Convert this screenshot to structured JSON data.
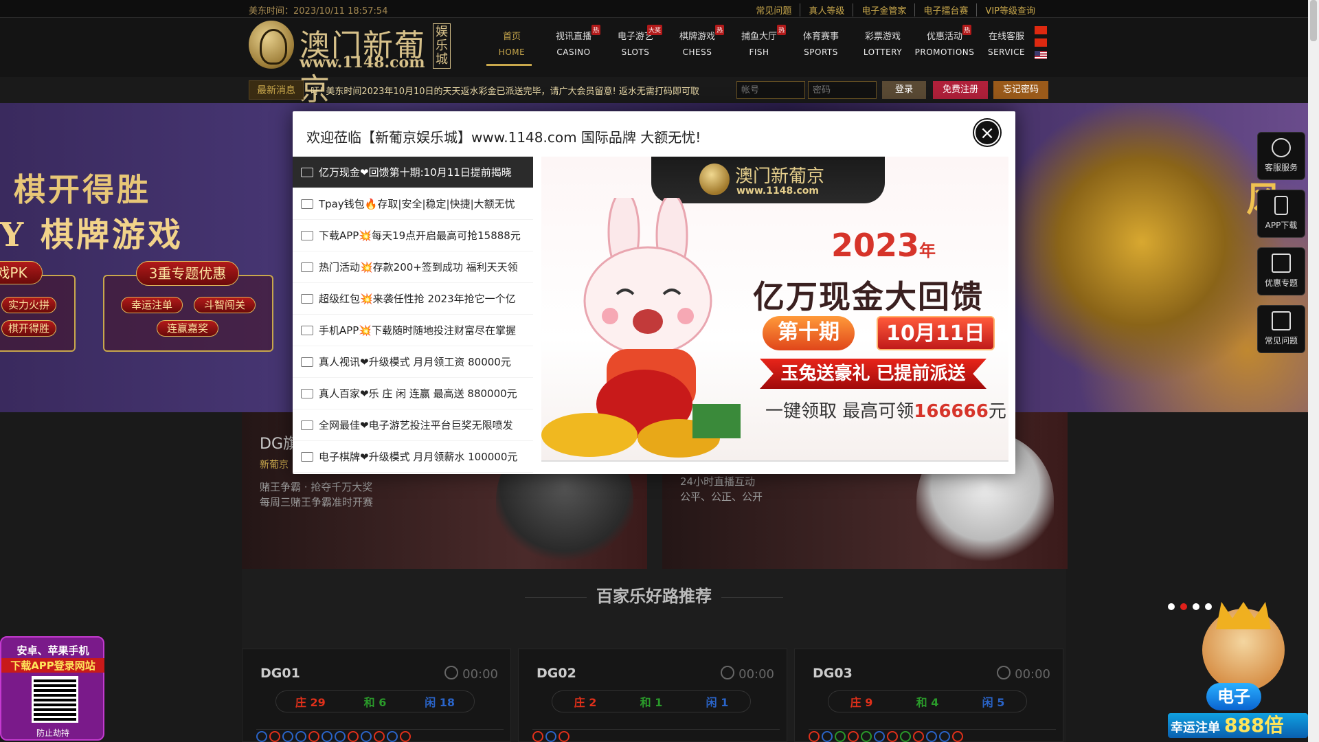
{
  "topbar": {
    "time_label": "美东时间：",
    "time_value": "2023/10/11 18:57:54",
    "links": [
      "常见问题",
      "真人等级",
      "电子金管家",
      "电子擂台赛",
      "VIP等级查询"
    ]
  },
  "logo": {
    "name": "澳门新葡京",
    "url": "www.1148.com",
    "vertical": "娱乐城"
  },
  "nav": [
    {
      "cn": "首页",
      "en": "HOME",
      "hot": ""
    },
    {
      "cn": "视讯直播",
      "en": "CASINO",
      "hot": "热"
    },
    {
      "cn": "电子游艺",
      "en": "SLOTS",
      "hot": "大奖"
    },
    {
      "cn": "棋牌游戏",
      "en": "CHESS",
      "hot": "热"
    },
    {
      "cn": "捕鱼大厅",
      "en": "FISH",
      "hot": "热"
    },
    {
      "cn": "体育赛事",
      "en": "SPORTS",
      "hot": ""
    },
    {
      "cn": "彩票游戏",
      "en": "LOTTERY",
      "hot": ""
    },
    {
      "cn": "优惠活动",
      "en": "PROMOTIONS",
      "hot": "热"
    },
    {
      "cn": "在线客服",
      "en": "SERVICE",
      "hot": ""
    }
  ],
  "newsbar": {
    "tag": "最新消息",
    "message": "吁! 美东时间2023年10月10日的天天返水彩金已派送完毕，请广大会员留意! 返水无需打码即可取",
    "account_placeholder": "帐号",
    "password_placeholder": "密码",
    "login": "登录",
    "register": "免费注册",
    "forgot": "忘记密码"
  },
  "banner": {
    "title1": "棋开得胜",
    "title2": "Y 棋牌游戏",
    "panel1_title": "戏PK",
    "panel1_items": [
      "实力火拼",
      "棋开得胜"
    ],
    "panel2_title": "3重专题优惠",
    "panel2_items": [
      "幸运注单",
      "斗智闯关",
      "连赢嘉奖"
    ],
    "right_text": "风"
  },
  "side": [
    {
      "label": "客服服务",
      "icon": "headset-icon"
    },
    {
      "label": "APP下载",
      "icon": "phone-icon"
    },
    {
      "label": "优惠专题",
      "icon": "gift-icon"
    },
    {
      "label": "常见问题",
      "icon": "question-icon"
    }
  ],
  "cards": [
    {
      "title": "DG旗",
      "sub": "新葡京",
      "desc1": "赌王争霸 · 抢夺千万大奖",
      "desc2": "每周三赌王争霸准时开赛"
    },
    {
      "title": "",
      "sub": "",
      "desc1": "24小时直播互动",
      "desc2": "公平、公正、公开"
    }
  ],
  "road": {
    "title": "百家乐好路推荐",
    "tables": [
      {
        "name": "DG01",
        "timer": "00:00",
        "banker": "庄 29",
        "tie": "和 6",
        "player": "闲 18"
      },
      {
        "name": "DG02",
        "timer": "00:00",
        "banker": "庄 2",
        "tie": "和 1",
        "player": "闲 1"
      },
      {
        "name": "DG03",
        "timer": "00:00",
        "banker": "庄 9",
        "tie": "和 4",
        "player": "闲 5"
      }
    ]
  },
  "modal": {
    "title": "欢迎莅临【新葡京娱乐城】www.1148.com 国际品牌 大额无忧!",
    "close": "×",
    "items": [
      "亿万现金❤回馈第十期:10月11日提前揭晓",
      "Tpay钱包🔥存取|安全|稳定|快捷|大额无忧",
      "下载APP💥每天19点开启最高可抢15888元",
      "热门活动💥存款200+签到成功 福利天天领",
      "超级红包💥来袭任性抢 2023年抢它一个亿",
      "手机APP💥下载随时随地投注财富尽在掌握",
      "真人视讯❤升级模式 月月领工资 80000元",
      "真人百家❤乐 庄 闲 连赢 最高送 880000元",
      "全网最佳❤电子游艺投注平台巨奖无限喷发",
      "电子棋牌❤升级模式 月月领薪水 100000元"
    ],
    "promo": {
      "logo_name": "澳门新葡京",
      "logo_url": "www.1148.com",
      "year": "2023",
      "year_suffix": "年",
      "headline": "亿万现金大回馈",
      "issue": "第十期",
      "date": "10月11日",
      "ribbon": "玉兔送豪礼 已提前派送",
      "claim_prefix": "一键领取 最高可领",
      "claim_amount": "166666",
      "claim_suffix": "元"
    }
  },
  "appbox": {
    "line1": "安卓、苹果手机",
    "line2": "下载APP登录网站",
    "line3": "防止劫持"
  },
  "king": {
    "game": "电子",
    "bar_text": "幸运注单",
    "multiplier": "888倍"
  },
  "colors": {
    "gold": "#c9a84c",
    "banker": "#e0301a",
    "tie": "#2a9a2a",
    "player": "#2a64c8"
  }
}
